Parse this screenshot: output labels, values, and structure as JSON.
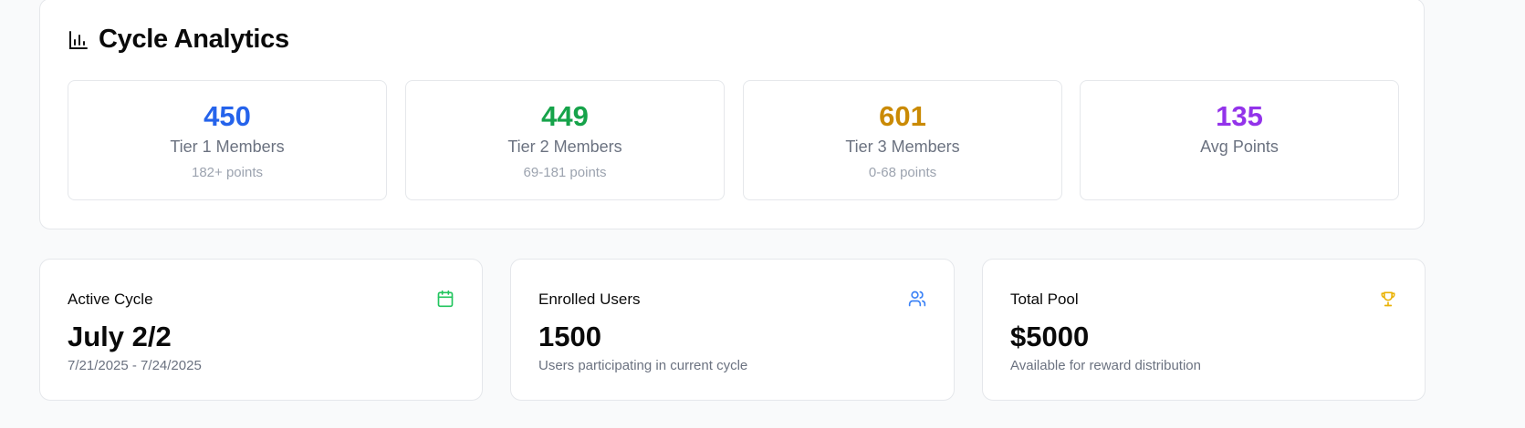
{
  "analytics": {
    "title": "Cycle Analytics",
    "icon": "bar-chart-icon",
    "stats": [
      {
        "value": "450",
        "label": "Tier 1 Members",
        "sub": "182+ points",
        "color": "#2563eb"
      },
      {
        "value": "449",
        "label": "Tier 2 Members",
        "sub": "69-181 points",
        "color": "#16a34a"
      },
      {
        "value": "601",
        "label": "Tier 3 Members",
        "sub": "0-68 points",
        "color": "#ca8a04"
      },
      {
        "value": "135",
        "label": "Avg Points",
        "sub": "",
        "color": "#9333ea"
      }
    ]
  },
  "cards": [
    {
      "title": "Active Cycle",
      "value": "July 2/2",
      "sub": "7/21/2025 - 7/24/2025",
      "icon": "calendar-icon",
      "icon_color": "#22c55e"
    },
    {
      "title": "Enrolled Users",
      "value": "1500",
      "sub": "Users participating in current cycle",
      "icon": "users-icon",
      "icon_color": "#3b82f6"
    },
    {
      "title": "Total Pool",
      "value": "$5000",
      "sub": "Available for reward distribution",
      "icon": "trophy-icon",
      "icon_color": "#eab308"
    }
  ]
}
